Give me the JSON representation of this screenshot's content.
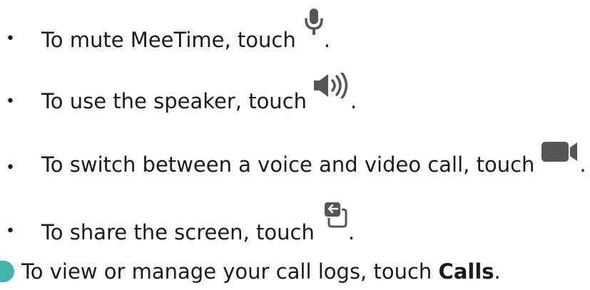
{
  "bullets": [
    {
      "text": "To mute MeeTime, touch",
      "icon": "microphone-icon",
      "suffix": "."
    },
    {
      "text": "To use the speaker, touch",
      "icon": "speaker-icon",
      "suffix": "."
    },
    {
      "text": "To switch between a voice and video call, touch",
      "icon": "video-camera-icon",
      "suffix": "."
    },
    {
      "text": "To share the screen, touch",
      "icon": "screen-share-icon",
      "suffix": "."
    }
  ],
  "bullet_symbol": "•",
  "footer": {
    "prefix": "To view or manage your call logs, touch ",
    "bold": "Calls",
    "suffix": "."
  },
  "colors": {
    "text": "#1a1a1a",
    "icon": "#555555",
    "accent": "#43b3ae"
  }
}
